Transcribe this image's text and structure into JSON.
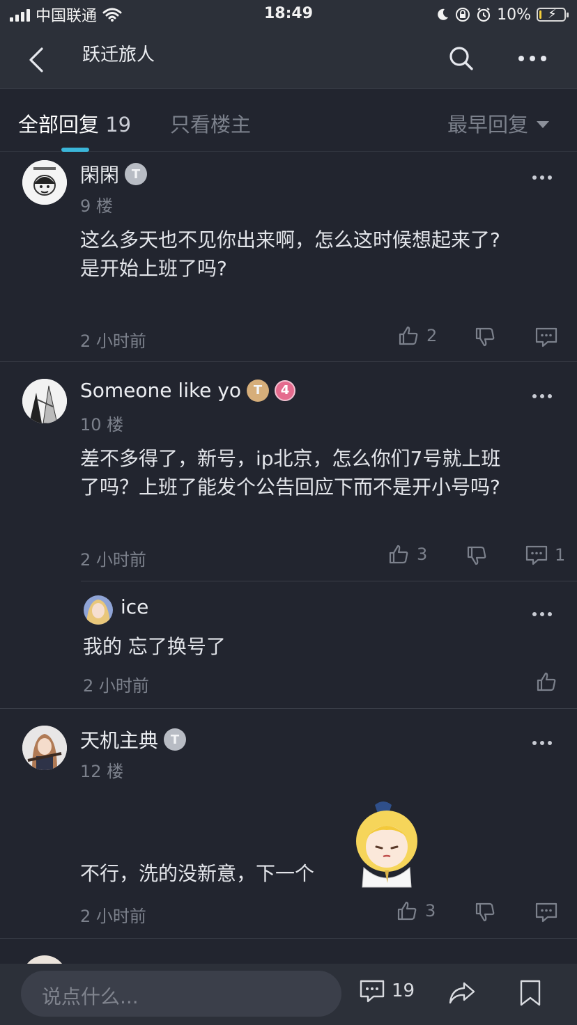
{
  "status_bar": {
    "carrier": "中国联通",
    "time": "18:49",
    "battery_percent": "10%",
    "battery_level": 0.1,
    "battery_color": "#f4cf3b"
  },
  "nav": {
    "title": "跃迁旅人",
    "back_icon": "chevron-left-icon",
    "search_icon": "search-icon",
    "more_icon": "more-horizontal-icon"
  },
  "tabs": {
    "all_label": "全部回复",
    "all_count": "19",
    "owner_label": "只看楼主",
    "sort_label": "最早回复",
    "accent_color": "#3bb6d9"
  },
  "posts": [
    {
      "username": "閑閑",
      "badge": "T",
      "floor": "9 楼",
      "content_line1": "这么多天也不见你出来啊，怎么这时候想起来了?",
      "content_line2": "是开始上班了吗?",
      "time": "2 小时前",
      "likes": "2",
      "comments": ""
    },
    {
      "username": "Someone like yo",
      "badge": "T",
      "level": "4",
      "floor": "10 楼",
      "content_line1": "差不多得了，新号，ip北京，怎么你们7号就上班",
      "content_line2": "了吗？上班了能发个公告回应下而不是开小号吗?",
      "time": "2 小时前",
      "likes": "3",
      "comments": "1",
      "reply": {
        "username": "ice",
        "content": "我的 忘了换号了",
        "time": "2 小时前"
      }
    },
    {
      "username": "天机主典",
      "badge": "T",
      "floor": "12 楼",
      "content": "不行，洗的没新意，下一个",
      "time": "2 小时前",
      "likes": "3"
    }
  ],
  "bottom_bar": {
    "placeholder": "说点什么...",
    "comment_count": "19"
  }
}
